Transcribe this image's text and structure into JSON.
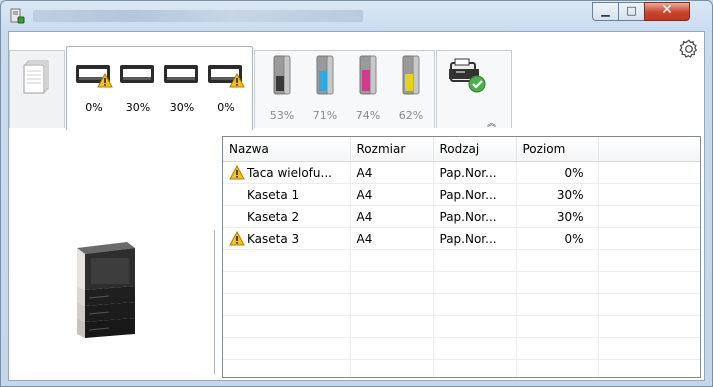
{
  "window": {
    "minimize_glyph": "▁",
    "maximize_glyph": "□",
    "close_glyph": "✕"
  },
  "trays": [
    {
      "level": "0%",
      "warning": true
    },
    {
      "level": "30%",
      "warning": false
    },
    {
      "level": "30%",
      "warning": false
    },
    {
      "level": "0%",
      "warning": true
    }
  ],
  "toners": [
    {
      "level": "53%",
      "color": "#3a3a3a"
    },
    {
      "level": "71%",
      "color": "#2fa9dc"
    },
    {
      "level": "74%",
      "color": "#d23a8f"
    },
    {
      "level": "62%",
      "color": "#e6d21b"
    }
  ],
  "table": {
    "headers": [
      "Nazwa",
      "Rozmiar",
      "Rodzaj",
      "Poziom"
    ],
    "rows": [
      {
        "name": "Taca wielofu...",
        "size": "A4",
        "type": "Pap.Nor...",
        "level": "0%",
        "warning": true
      },
      {
        "name": "Kaseta 1",
        "size": "A4",
        "type": "Pap.Nor...",
        "level": "30%",
        "warning": false
      },
      {
        "name": "Kaseta 2",
        "size": "A4",
        "type": "Pap.Nor...",
        "level": "30%",
        "warning": false
      },
      {
        "name": "Kaseta 3",
        "size": "A4",
        "type": "Pap.Nor...",
        "level": "0%",
        "warning": true
      }
    ]
  },
  "icons": {
    "app": "printer-app-icon",
    "gear": "gear-icon",
    "collapse": "chevron-up-icon",
    "warning": "warning-icon",
    "paper_stack": "paper-stack-icon",
    "device": "device-check-icon"
  },
  "collapse_glyph": "︽"
}
